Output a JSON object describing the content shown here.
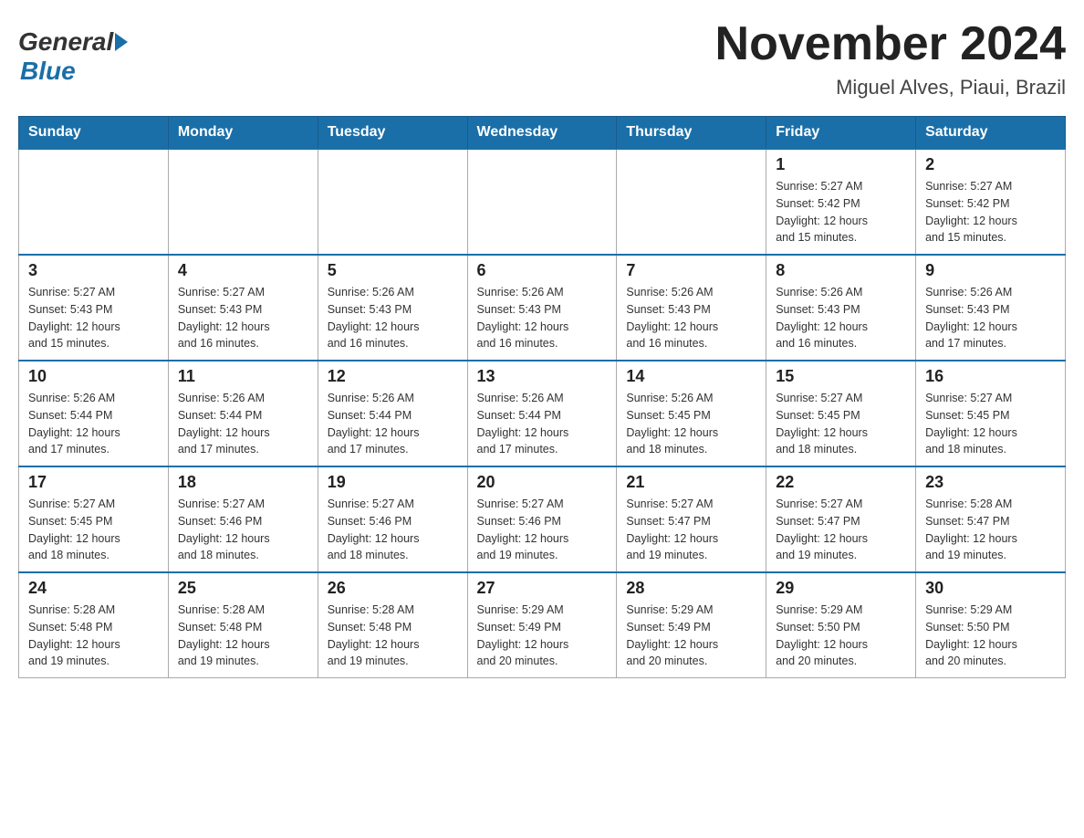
{
  "header": {
    "logo_general": "General",
    "logo_blue": "Blue",
    "month_title": "November 2024",
    "location": "Miguel Alves, Piaui, Brazil"
  },
  "weekdays": [
    "Sunday",
    "Monday",
    "Tuesday",
    "Wednesday",
    "Thursday",
    "Friday",
    "Saturday"
  ],
  "weeks": [
    [
      {
        "day": "",
        "info": ""
      },
      {
        "day": "",
        "info": ""
      },
      {
        "day": "",
        "info": ""
      },
      {
        "day": "",
        "info": ""
      },
      {
        "day": "",
        "info": ""
      },
      {
        "day": "1",
        "info": "Sunrise: 5:27 AM\nSunset: 5:42 PM\nDaylight: 12 hours\nand 15 minutes."
      },
      {
        "day": "2",
        "info": "Sunrise: 5:27 AM\nSunset: 5:42 PM\nDaylight: 12 hours\nand 15 minutes."
      }
    ],
    [
      {
        "day": "3",
        "info": "Sunrise: 5:27 AM\nSunset: 5:43 PM\nDaylight: 12 hours\nand 15 minutes."
      },
      {
        "day": "4",
        "info": "Sunrise: 5:27 AM\nSunset: 5:43 PM\nDaylight: 12 hours\nand 16 minutes."
      },
      {
        "day": "5",
        "info": "Sunrise: 5:26 AM\nSunset: 5:43 PM\nDaylight: 12 hours\nand 16 minutes."
      },
      {
        "day": "6",
        "info": "Sunrise: 5:26 AM\nSunset: 5:43 PM\nDaylight: 12 hours\nand 16 minutes."
      },
      {
        "day": "7",
        "info": "Sunrise: 5:26 AM\nSunset: 5:43 PM\nDaylight: 12 hours\nand 16 minutes."
      },
      {
        "day": "8",
        "info": "Sunrise: 5:26 AM\nSunset: 5:43 PM\nDaylight: 12 hours\nand 16 minutes."
      },
      {
        "day": "9",
        "info": "Sunrise: 5:26 AM\nSunset: 5:43 PM\nDaylight: 12 hours\nand 17 minutes."
      }
    ],
    [
      {
        "day": "10",
        "info": "Sunrise: 5:26 AM\nSunset: 5:44 PM\nDaylight: 12 hours\nand 17 minutes."
      },
      {
        "day": "11",
        "info": "Sunrise: 5:26 AM\nSunset: 5:44 PM\nDaylight: 12 hours\nand 17 minutes."
      },
      {
        "day": "12",
        "info": "Sunrise: 5:26 AM\nSunset: 5:44 PM\nDaylight: 12 hours\nand 17 minutes."
      },
      {
        "day": "13",
        "info": "Sunrise: 5:26 AM\nSunset: 5:44 PM\nDaylight: 12 hours\nand 17 minutes."
      },
      {
        "day": "14",
        "info": "Sunrise: 5:26 AM\nSunset: 5:45 PM\nDaylight: 12 hours\nand 18 minutes."
      },
      {
        "day": "15",
        "info": "Sunrise: 5:27 AM\nSunset: 5:45 PM\nDaylight: 12 hours\nand 18 minutes."
      },
      {
        "day": "16",
        "info": "Sunrise: 5:27 AM\nSunset: 5:45 PM\nDaylight: 12 hours\nand 18 minutes."
      }
    ],
    [
      {
        "day": "17",
        "info": "Sunrise: 5:27 AM\nSunset: 5:45 PM\nDaylight: 12 hours\nand 18 minutes."
      },
      {
        "day": "18",
        "info": "Sunrise: 5:27 AM\nSunset: 5:46 PM\nDaylight: 12 hours\nand 18 minutes."
      },
      {
        "day": "19",
        "info": "Sunrise: 5:27 AM\nSunset: 5:46 PM\nDaylight: 12 hours\nand 18 minutes."
      },
      {
        "day": "20",
        "info": "Sunrise: 5:27 AM\nSunset: 5:46 PM\nDaylight: 12 hours\nand 19 minutes."
      },
      {
        "day": "21",
        "info": "Sunrise: 5:27 AM\nSunset: 5:47 PM\nDaylight: 12 hours\nand 19 minutes."
      },
      {
        "day": "22",
        "info": "Sunrise: 5:27 AM\nSunset: 5:47 PM\nDaylight: 12 hours\nand 19 minutes."
      },
      {
        "day": "23",
        "info": "Sunrise: 5:28 AM\nSunset: 5:47 PM\nDaylight: 12 hours\nand 19 minutes."
      }
    ],
    [
      {
        "day": "24",
        "info": "Sunrise: 5:28 AM\nSunset: 5:48 PM\nDaylight: 12 hours\nand 19 minutes."
      },
      {
        "day": "25",
        "info": "Sunrise: 5:28 AM\nSunset: 5:48 PM\nDaylight: 12 hours\nand 19 minutes."
      },
      {
        "day": "26",
        "info": "Sunrise: 5:28 AM\nSunset: 5:48 PM\nDaylight: 12 hours\nand 19 minutes."
      },
      {
        "day": "27",
        "info": "Sunrise: 5:29 AM\nSunset: 5:49 PM\nDaylight: 12 hours\nand 20 minutes."
      },
      {
        "day": "28",
        "info": "Sunrise: 5:29 AM\nSunset: 5:49 PM\nDaylight: 12 hours\nand 20 minutes."
      },
      {
        "day": "29",
        "info": "Sunrise: 5:29 AM\nSunset: 5:50 PM\nDaylight: 12 hours\nand 20 minutes."
      },
      {
        "day": "30",
        "info": "Sunrise: 5:29 AM\nSunset: 5:50 PM\nDaylight: 12 hours\nand 20 minutes."
      }
    ]
  ]
}
